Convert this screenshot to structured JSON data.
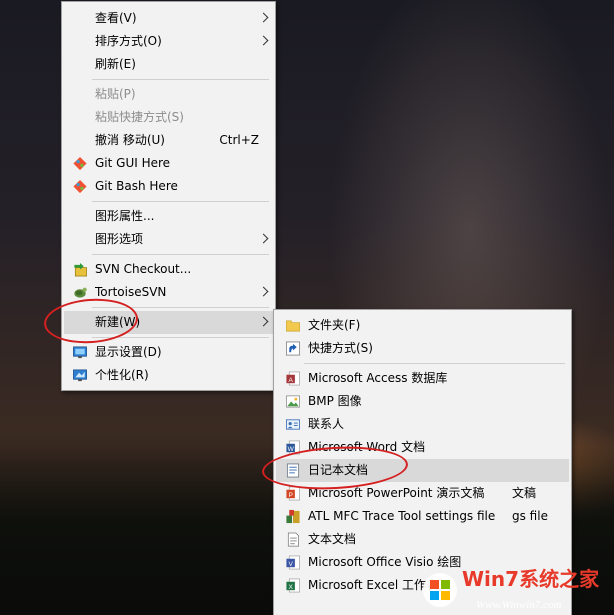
{
  "main_menu": {
    "items": [
      {
        "label": "查看(V)",
        "submenu": true
      },
      {
        "label": "排序方式(O)",
        "submenu": true
      },
      {
        "label": "刷新(E)"
      },
      {
        "label": "粘贴(P)",
        "disabled": true
      },
      {
        "label": "粘贴快捷方式(S)",
        "disabled": true
      },
      {
        "label": "撤消 移动(U)",
        "shortcut": "Ctrl+Z"
      },
      {
        "label": "Git GUI Here",
        "icon": "git-gui-icon"
      },
      {
        "label": "Git Bash Here",
        "icon": "git-bash-icon"
      },
      {
        "label": "图形属性...",
        "icon": "none"
      },
      {
        "label": "图形选项",
        "submenu": true
      },
      {
        "label": "SVN Checkout...",
        "icon": "svn-checkout-icon"
      },
      {
        "label": "TortoiseSVN",
        "icon": "tortoise-icon",
        "submenu": true
      },
      {
        "label": "新建(W)",
        "submenu": true,
        "highlighted": true
      },
      {
        "label": "显示设置(D)",
        "icon": "display-settings-icon"
      },
      {
        "label": "个性化(R)",
        "icon": "personalize-icon"
      }
    ]
  },
  "new_menu": {
    "items": [
      {
        "label": "文件夹(F)",
        "icon": "folder-icon"
      },
      {
        "label": "快捷方式(S)",
        "icon": "shortcut-icon"
      },
      {
        "label": "Microsoft Access 数据库",
        "icon": "access-icon"
      },
      {
        "label": "BMP 图像",
        "icon": "bmp-icon"
      },
      {
        "label": "联系人",
        "icon": "contact-icon"
      },
      {
        "label": "Microsoft Word 文档",
        "icon": "word-icon"
      },
      {
        "label": "日记本文档",
        "icon": "journal-icon",
        "highlighted": true
      },
      {
        "label": "Microsoft PowerPoint 演示文稿",
        "icon": "powerpoint-icon",
        "tail": "文稿"
      },
      {
        "label": "ATL MFC Trace Tool settings file",
        "icon": "atl-icon",
        "tail": "gs file"
      },
      {
        "label": "文本文档",
        "icon": "text-icon"
      },
      {
        "label": "Microsoft Office Visio 绘图",
        "icon": "visio-icon"
      },
      {
        "label": "Microsoft Excel 工作表",
        "icon": "excel-icon"
      }
    ]
  },
  "watermark": {
    "brand": "Win7系统之家",
    "url": "Www.Winwin7.com"
  },
  "colors": {
    "menu_bg": "#f2f2f2",
    "highlight": "#d9d9d9",
    "annotation_red": "#d42020"
  }
}
